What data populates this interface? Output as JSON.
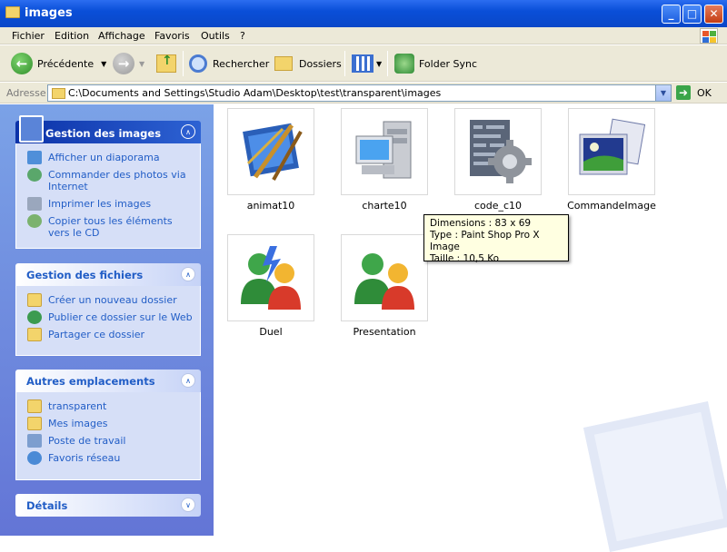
{
  "window": {
    "title": "images",
    "buttons": [
      "_",
      "□",
      "✕"
    ]
  },
  "menu": [
    "Fichier",
    "Edition",
    "Affichage",
    "Favoris",
    "Outils",
    "?"
  ],
  "toolbar": {
    "back_label": "Précédente",
    "search_label": "Rechercher",
    "folders_label": "Dossiers",
    "foldersync_label": "Folder Sync"
  },
  "address": {
    "label": "Adresse",
    "path": "C:\\Documents and Settings\\Studio Adam\\Desktop\\test\\transparent\\images",
    "go_label": "OK"
  },
  "panels": {
    "images": {
      "title": "Gestion des images",
      "tasks": [
        "Afficher un diaporama",
        "Commander des photos via Internet",
        "Imprimer les images",
        "Copier tous les éléments vers le CD"
      ]
    },
    "files": {
      "title": "Gestion des fichiers",
      "tasks": [
        "Créer un nouveau dossier",
        "Publier ce dossier sur le Web",
        "Partager ce dossier"
      ]
    },
    "places": {
      "title": "Autres emplacements",
      "items": [
        "transparent",
        "Mes images",
        "Poste de travail",
        "Favoris réseau"
      ]
    },
    "details": {
      "title": "Détails"
    }
  },
  "files": [
    {
      "name": "animat10",
      "icon": "paint-brushes-icon"
    },
    {
      "name": "charte10",
      "icon": "computer-icon"
    },
    {
      "name": "code_c10",
      "icon": "code-gear-icon"
    },
    {
      "name": "CommandeImage",
      "icon": "photo-frame-icon"
    },
    {
      "name": "Duel",
      "icon": "users-duel-icon"
    },
    {
      "name": "Presentation",
      "icon": "users-icon"
    }
  ],
  "tooltip": {
    "dimensions": "Dimensions : 83 x 69",
    "type": "Type : Paint Shop Pro X Image",
    "size": "Taille  : 10,5 Ko"
  },
  "colors": {
    "titlebar": "#0a4fd8",
    "task_link": "#215dc6",
    "leftpane": "#6f8fe0"
  }
}
